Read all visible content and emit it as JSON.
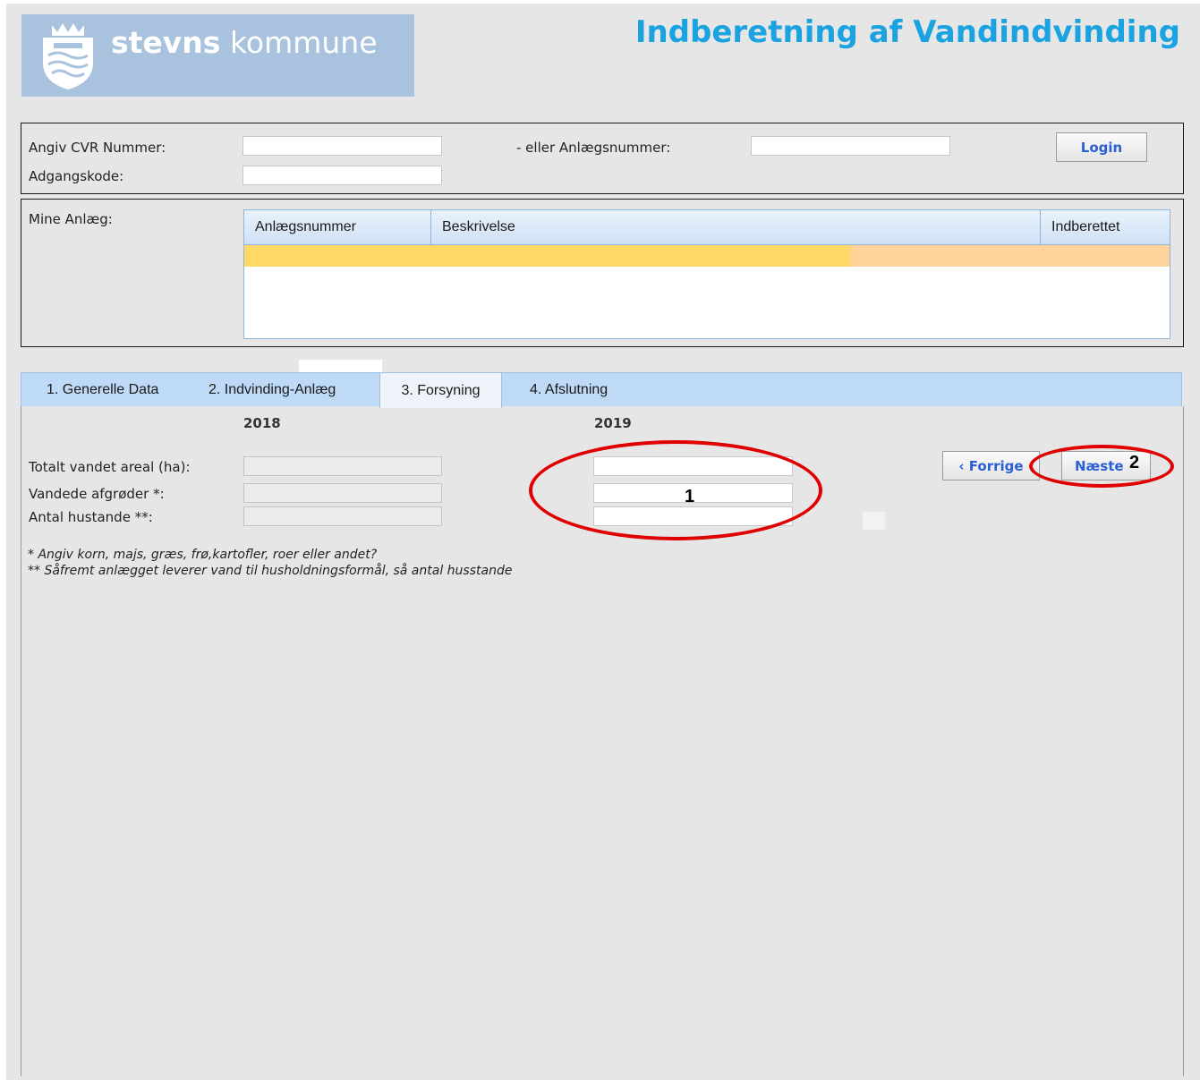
{
  "header": {
    "logo_bold": "stevns",
    "logo_rest": " kommune",
    "app_title": "Indberetning af Vandindvinding"
  },
  "login": {
    "cvr_label": "Angiv CVR Nummer:",
    "cvr_value": "",
    "anlaeg_label": "- eller Anlægsnummer:",
    "anlaeg_value": "",
    "password_label": "Adgangskode:",
    "password_value": "",
    "login_button": "Login"
  },
  "mine_anlaeg": {
    "label": "Mine Anlæg:",
    "columns": [
      "Anlægsnummer",
      "Beskrivelse",
      "Indberettet"
    ]
  },
  "tabs": [
    {
      "label": "1. Generelle Data"
    },
    {
      "label": "2. Indvinding-Anlæg"
    },
    {
      "label": "3. Forsyning"
    },
    {
      "label": "4. Afslutning"
    }
  ],
  "form": {
    "year_prev": "2018",
    "year_curr": "2019",
    "rows": [
      {
        "label": "Totalt vandet areal (ha):",
        "prev": "",
        "curr": ""
      },
      {
        "label": "Vandede afgrøder *:",
        "prev": "",
        "curr": ""
      },
      {
        "label": "Antal hustande **:",
        "prev": "",
        "curr": ""
      }
    ],
    "note1": "* Angiv korn, majs, græs, frø,kartofler, roer eller andet?",
    "note2": "** Såfremt anlægget leverer vand til husholdningsformål, så antal husstande"
  },
  "nav": {
    "prev_button": "‹ Forrige",
    "next_button": "Næste"
  },
  "annotations": {
    "one": "1",
    "two": "2",
    "color": "#e00000"
  }
}
